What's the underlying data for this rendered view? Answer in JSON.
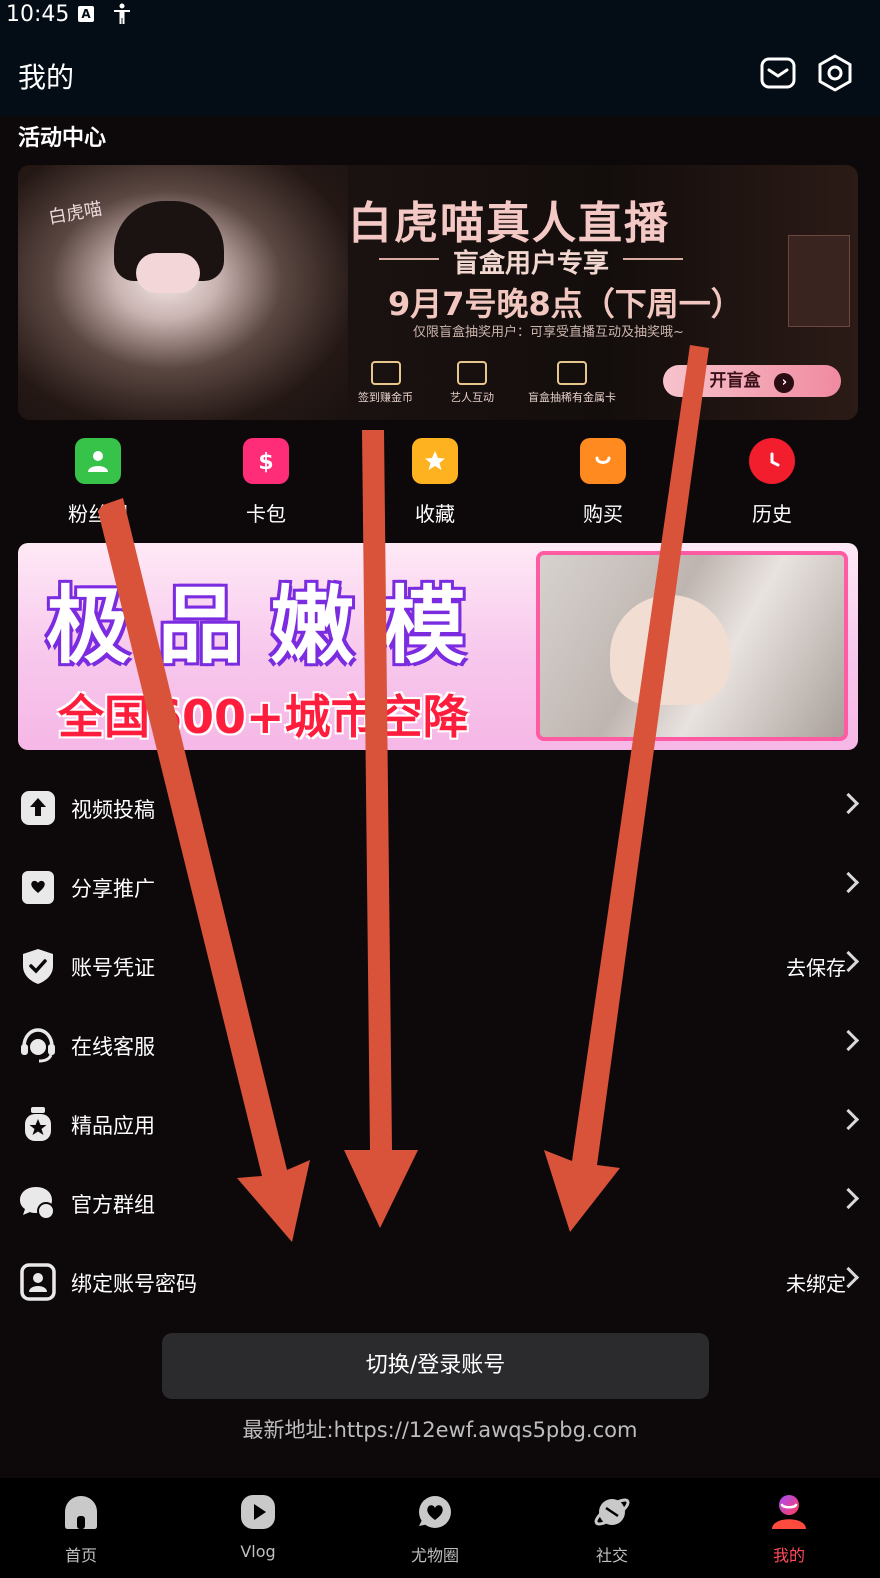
{
  "status_bar": {
    "time": "10:45",
    "notif_letter": "A"
  },
  "header": {
    "title": "我的"
  },
  "activity": {
    "section_title": "活动中心",
    "banner": {
      "script_text": "白虎喵",
      "headline": "白虎喵真人直播",
      "subheadline": "盲盒用户专享",
      "datetime": "9月7号晚8点（下周一）",
      "note": "仅限盲盒抽奖用户：可享受直播互动及抽奖哦~",
      "features": [
        "签到赚金币",
        "艺人互动",
        "盲盒抽稀有金属卡"
      ],
      "button_label": "开盲盒",
      "button_arrow": "›"
    }
  },
  "quick_actions": [
    {
      "label": "粉丝团",
      "icon": "fan-club-icon",
      "color": "#37c24a"
    },
    {
      "label": "卡包",
      "icon": "wallet-icon",
      "color": "#ff2d78"
    },
    {
      "label": "收藏",
      "icon": "star-icon",
      "color": "#ffb21f"
    },
    {
      "label": "购买",
      "icon": "shopping-bag-icon",
      "color": "#ff8a1f"
    },
    {
      "label": "历史",
      "icon": "clock-icon",
      "color": "#f21d2d"
    }
  ],
  "promo_banner": {
    "headline": "极品嫩模",
    "subline": "全国600+城市空降"
  },
  "menu_items": [
    {
      "label": "视频投稿",
      "value": "",
      "icon": "upload-icon"
    },
    {
      "label": "分享推广",
      "value": "",
      "icon": "share-icon"
    },
    {
      "label": "账号凭证",
      "value": "去保存",
      "icon": "shield-icon"
    },
    {
      "label": "在线客服",
      "value": "",
      "icon": "headset-icon"
    },
    {
      "label": "精品应用",
      "value": "",
      "icon": "apps-icon"
    },
    {
      "label": "官方群组",
      "value": "",
      "icon": "chat-group-icon"
    },
    {
      "label": "绑定账号密码",
      "value": "未绑定",
      "icon": "id-card-icon"
    }
  ],
  "switch_button": {
    "label": "切换/登录账号"
  },
  "latest_address": "最新地址:https://12ewf.awqs5pbg.com",
  "tab_bar": [
    {
      "label": "首页",
      "icon": "home-icon",
      "active": false
    },
    {
      "label": "Vlog",
      "icon": "play-icon",
      "active": false
    },
    {
      "label": "尤物圈",
      "icon": "heart-bubble-icon",
      "active": false
    },
    {
      "label": "社交",
      "icon": "planet-icon",
      "active": false
    },
    {
      "label": "我的",
      "icon": "profile-icon",
      "active": true
    }
  ],
  "colors": {
    "background": "#0d090b",
    "appbar": "#040c16",
    "accent": "#ff4b5c",
    "arrow_overlay": "#d9533a"
  }
}
